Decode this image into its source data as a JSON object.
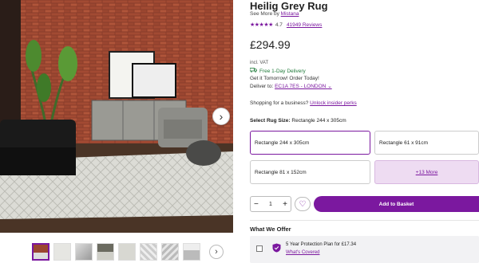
{
  "product": {
    "title": "Heilig Grey Rug",
    "see_more_prefix": "See More by",
    "brand": "Mistana",
    "stars": "★★★★★",
    "rating": "4.7",
    "reviews": "41949 Reviews",
    "price": "£294.99",
    "vat": "incl. VAT"
  },
  "delivery": {
    "free": "Free 1-Day Delivery",
    "tomorrow": "Get it Tomorrow! Order Today!",
    "deliver_to_prefix": "Deliver to:",
    "postcode": "EC1A 7ES - LONDON"
  },
  "business": {
    "prefix": "Shopping for a business?",
    "link": "Unlock insider perks"
  },
  "size": {
    "label": "Select Rug Size:",
    "selected_value": "Rectangle 244 x 305cm",
    "options": [
      "Rectangle 244 x 305cm",
      "Rectangle 61 x 91cm",
      "Rectangle 81 x 152cm"
    ],
    "more": "+13 More"
  },
  "cart": {
    "minus": "−",
    "quantity": "1",
    "plus": "+",
    "add_label": "Add to Basket"
  },
  "offers": {
    "title": "What We Offer",
    "plan": "5 Year Protection Plan for £17.34",
    "link": "What's Covered"
  },
  "icons": {
    "next": "chevron-right-icon",
    "favourite": "heart-icon",
    "delivery": "truck-icon",
    "protection": "shield-icon"
  },
  "colors": {
    "accent": "#7b189f",
    "delivery_green": "#1f7a3a"
  }
}
